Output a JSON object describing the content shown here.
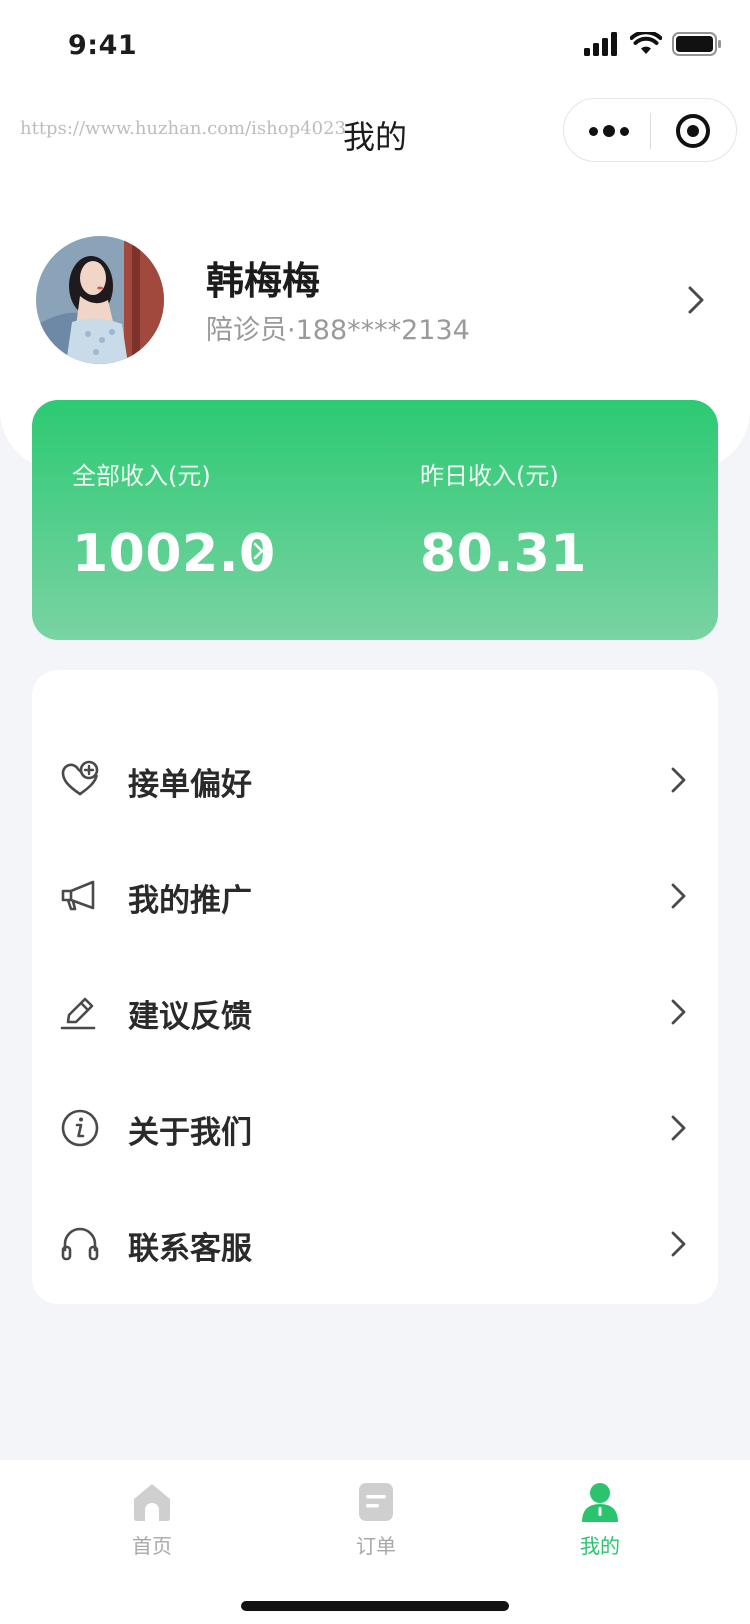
{
  "status_bar": {
    "time": "9:41"
  },
  "navbar": {
    "watermark": "https://www.huzhan.com/ishop40236",
    "title": "我的"
  },
  "profile": {
    "name": "韩梅梅",
    "subtitle": "陪诊员·188****2134"
  },
  "income": {
    "total_label": "全部收入(元)",
    "total_value": "1002.0",
    "yesterday_label": "昨日收入(元)",
    "yesterday_value": "80.31"
  },
  "menu": {
    "items": [
      {
        "label": "接单偏好",
        "icon": "heart-plus-icon"
      },
      {
        "label": "我的推广",
        "icon": "megaphone-icon"
      },
      {
        "label": "建议反馈",
        "icon": "pen-icon"
      },
      {
        "label": "关于我们",
        "icon": "info-icon"
      },
      {
        "label": "联系客服",
        "icon": "headset-icon"
      }
    ]
  },
  "tabbar": {
    "tabs": [
      {
        "label": "首页",
        "icon": "home-icon",
        "active": false
      },
      {
        "label": "订单",
        "icon": "order-icon",
        "active": false
      },
      {
        "label": "我的",
        "icon": "user-icon",
        "active": true
      }
    ]
  },
  "colors": {
    "accent": "#2cc36e",
    "card_gradient_top": "#2cca73",
    "card_gradient_bottom": "#7ad3a3",
    "background": "#f4f5f9"
  }
}
